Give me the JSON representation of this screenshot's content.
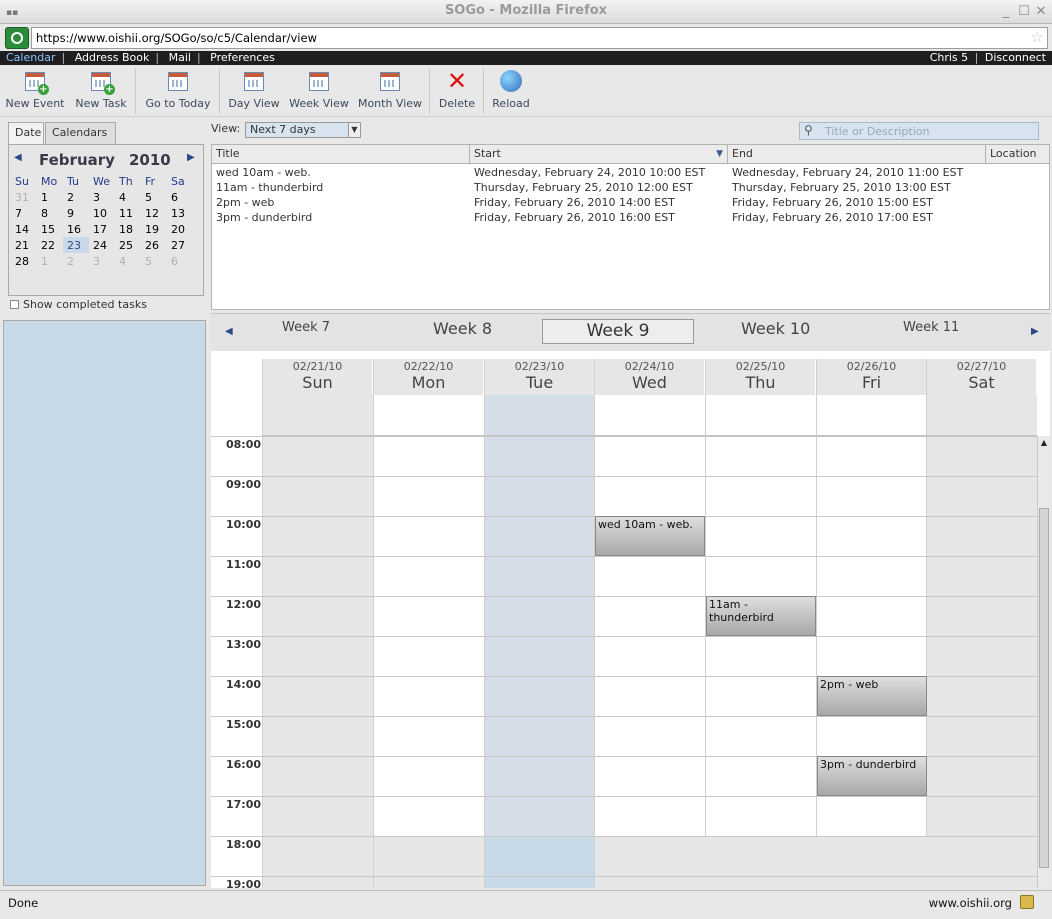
{
  "window": {
    "title": "SOGo - Mozilla Firefox"
  },
  "browser": {
    "url": "https://www.oishii.org/SOGo/so/c5/Calendar/view"
  },
  "menu": {
    "items": [
      "Calendar",
      "Address Book",
      "Mail",
      "Preferences"
    ],
    "user": "Chris 5",
    "disconnect": "Disconnect"
  },
  "toolbar": {
    "new_event": "New Event",
    "new_task": "New Task",
    "go_today": "Go to Today",
    "day_view": "Day View",
    "week_view": "Week View",
    "month_view": "Month View",
    "delete": "Delete",
    "reload": "Reload"
  },
  "left": {
    "tabs": [
      "Date",
      "Calendars"
    ],
    "month": "February",
    "year": "2010",
    "dow": [
      "Su",
      "Mo",
      "Tu",
      "We",
      "Th",
      "Fr",
      "Sa"
    ],
    "weeks": [
      [
        "31",
        "1",
        "2",
        "3",
        "4",
        "5",
        "6"
      ],
      [
        "7",
        "8",
        "9",
        "10",
        "11",
        "12",
        "13"
      ],
      [
        "14",
        "15",
        "16",
        "17",
        "18",
        "19",
        "20"
      ],
      [
        "21",
        "22",
        "23",
        "24",
        "25",
        "26",
        "27"
      ],
      [
        "28",
        "1",
        "2",
        "3",
        "4",
        "5",
        "6"
      ]
    ],
    "today": "23",
    "show_completed": "Show completed tasks"
  },
  "filter": {
    "view_label": "View:",
    "view_value": "Next 7 days",
    "search_placeholder": "Title or Description"
  },
  "list": {
    "columns": [
      "Title",
      "Start",
      "End",
      "Location"
    ],
    "rows": [
      {
        "title": "wed 10am - web.",
        "start": "Wednesday, February 24, 2010 10:00 EST",
        "end": "Wednesday, February 24, 2010 11:00 EST"
      },
      {
        "title": "11am - thunderbird",
        "start": "Thursday, February 25, 2010 12:00 EST",
        "end": "Thursday, February 25, 2010 13:00 EST"
      },
      {
        "title": "2pm - web",
        "start": "Friday, February 26, 2010 14:00 EST",
        "end": "Friday, February 26, 2010 15:00 EST"
      },
      {
        "title": "3pm - dunderbird",
        "start": "Friday, February 26, 2010 16:00 EST",
        "end": "Friday, February 26, 2010 17:00 EST"
      }
    ]
  },
  "weeknav": {
    "w7": "Week 7",
    "w8": "Week 8",
    "w9": "Week 9",
    "w10": "Week 10",
    "w11": "Week 11"
  },
  "week": {
    "days": [
      {
        "date": "02/21/10",
        "name": "Sun"
      },
      {
        "date": "02/22/10",
        "name": "Mon"
      },
      {
        "date": "02/23/10",
        "name": "Tue"
      },
      {
        "date": "02/24/10",
        "name": "Wed"
      },
      {
        "date": "02/25/10",
        "name": "Thu"
      },
      {
        "date": "02/26/10",
        "name": "Fri"
      },
      {
        "date": "02/27/10",
        "name": "Sat"
      }
    ],
    "hours": [
      "08:00",
      "09:00",
      "10:00",
      "11:00",
      "12:00",
      "13:00",
      "14:00",
      "15:00",
      "16:00",
      "17:00",
      "18:00",
      "19:00"
    ],
    "events": [
      {
        "title": "wed 10am - web."
      },
      {
        "title": "11am - thunderbird"
      },
      {
        "title": "2pm - web"
      },
      {
        "title": "3pm - dunderbird"
      }
    ]
  },
  "status": {
    "left": "Done",
    "right": "www.oishii.org"
  }
}
